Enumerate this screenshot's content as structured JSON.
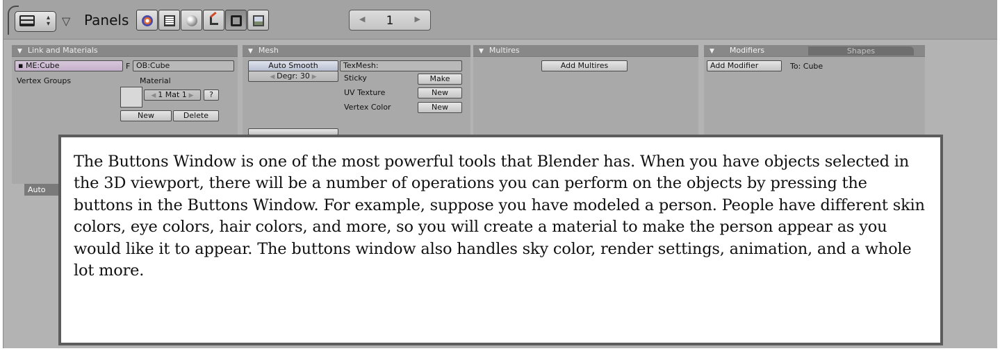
{
  "header": {
    "panels_label": "Panels",
    "window_type_icon": "buttons-window-icon",
    "context_buttons": [
      {
        "name": "logic-icon",
        "active": false
      },
      {
        "name": "script-icon",
        "active": false
      },
      {
        "name": "shading-icon",
        "active": false
      },
      {
        "name": "object-icon",
        "active": false
      },
      {
        "name": "editing-icon",
        "active": true
      },
      {
        "name": "scene-icon",
        "active": false
      }
    ],
    "frame": {
      "value": "1",
      "left_arrow": "◀",
      "right_arrow": "▶"
    }
  },
  "panels": {
    "link_materials": {
      "title": "Link and Materials",
      "mesh_name": "ME:Cube",
      "object_prefix": "F",
      "object_name": "OB:Cube",
      "vertex_groups_label": "Vertex Groups",
      "material_label": "Material",
      "material_slot": "1 Mat 1",
      "material_help": "?",
      "new_label": "New",
      "delete_label": "Delete"
    },
    "mesh": {
      "title": "Mesh",
      "auto_smooth": "Auto Smooth",
      "degr": "Degr: 30",
      "texmesh": "TexMesh:",
      "sticky_label": "Sticky",
      "sticky_button": "Make",
      "uv_texture_label": "UV Texture",
      "uv_texture_button": "New",
      "vertex_color_label": "Vertex Color",
      "vertex_color_button": "New"
    },
    "multires": {
      "title": "Multires",
      "add_button": "Add Multires"
    },
    "modifiers": {
      "title": "Modifiers",
      "shapes_tab": "Shapes",
      "add_button": "Add Modifier",
      "target_label": "To: Cube"
    }
  },
  "partially_hidden_button": "Auto",
  "overlay": {
    "text": "The Buttons Window is one of the most powerful tools that Blender has. When you have objects selected in the 3D viewport, there will be a number of operations you can perform on the objects by pressing the buttons in the Buttons Window. For example, suppose you have modeled a person. People have different skin colors, eye colors, hair colors, and more, so you will create a material to make the person appear as you would like it to appear. The buttons window also handles sky color, render settings, animation, and a whole lot more."
  }
}
